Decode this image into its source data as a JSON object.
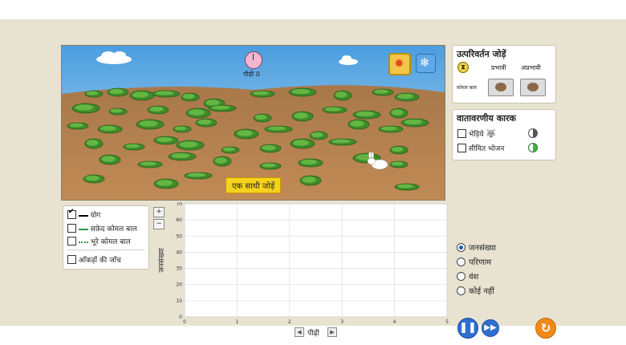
{
  "scene": {
    "generation_label": "पीढ़ी 0",
    "add_mate_button": "एक साथी जोड़ें",
    "sun_icon": "sun-icon",
    "snowflake_icon": "snowflake-icon"
  },
  "mutations_panel": {
    "title": "उत्परिवर्तन जोड़ें",
    "dominant_label": "प्रभावी",
    "recessive_label": "अप्रभावी",
    "trait_label": "कोमल बाल"
  },
  "environment_panel": {
    "title": "वातावरणीय कारक",
    "wolves_label": "भेड़िये",
    "limited_food_label": "सीमित भोजन"
  },
  "legend": {
    "total_label": "योग",
    "white_fur_label": "सफ़ेद कोमल बाल",
    "brown_fur_label": "भूरे कोमल बाल",
    "data_probe_label": "आँकड़ों की जाँच",
    "total_checked": true,
    "white_checked": false,
    "brown_checked": false,
    "probe_checked": false
  },
  "zoom": {
    "in": "+",
    "out": "−"
  },
  "chart_data": {
    "type": "line",
    "ylabel": "जनसंख्या",
    "xlabel": "पीढ़ी",
    "xlim": [
      0,
      5
    ],
    "ylim": [
      0,
      70
    ],
    "x_ticks": [
      "0",
      "1",
      "2",
      "3",
      "4",
      "5"
    ],
    "y_ticks": [
      "0",
      "10",
      "20",
      "30",
      "40",
      "50",
      "60",
      "70"
    ],
    "grid": true,
    "series": []
  },
  "view_options": {
    "items": [
      "जनसंख्या",
      "परिणाम",
      "वंश",
      "कोई नहीं"
    ],
    "selected": 0
  },
  "controls": {
    "play_pause_icon": "pause-icon",
    "fast_forward_icon": "fast-forward-icon",
    "reset_icon": "reset-icon"
  },
  "colors": {
    "sky_top": "#5aa7df",
    "ground": "#b07a45",
    "accent_yellow": "#f6d21c",
    "button_blue": "#2f6fd0",
    "reset_orange": "#f08a1a"
  }
}
